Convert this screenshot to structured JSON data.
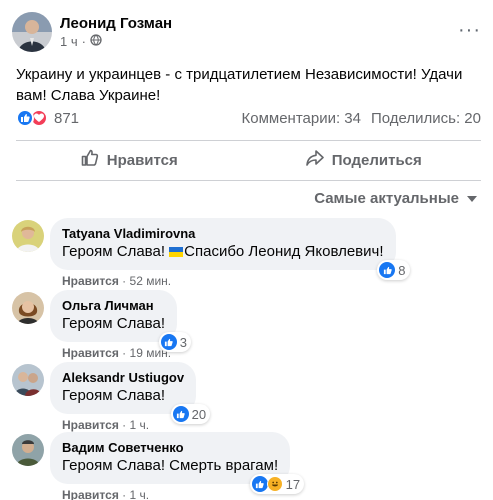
{
  "post": {
    "author": "Леонид Гозман",
    "time": "1 ч",
    "separator": "·",
    "more": "···",
    "text": "Украину и украинцев - с тридцатилетием Независимости! Удачи вам! Слава Украине!"
  },
  "stats": {
    "reactions": "871",
    "comments": "Комментарии: 34",
    "shares": "Поделились: 20"
  },
  "actions": {
    "like": "Нравится",
    "share": "Поделиться"
  },
  "sort": {
    "label": "Самые актуальные"
  },
  "comments": [
    {
      "name": "Tatyana Vladimirovna",
      "text_a": "Героям Слава! ",
      "text_b": "Спасибо Леонид Яковлевич!",
      "like": "Нравится",
      "sep": "·",
      "time": "52 мин.",
      "reactions": "8"
    },
    {
      "name": "Ольга Личман",
      "text": "Героям Слава!",
      "like": "Нравится",
      "sep": "·",
      "time": "19 мин.",
      "reactions": "3"
    },
    {
      "name": "Aleksandr Ustiugov",
      "text": "Героям Слава!",
      "like": "Нравится",
      "sep": "·",
      "time": "1 ч.",
      "reactions": "20"
    },
    {
      "name": "Вадим Советченко",
      "text": "Героям Слава! Смерть врагам!",
      "like": "Нравится",
      "sep": "·",
      "time": "1 ч.",
      "reactions": "17"
    }
  ],
  "colors": {
    "brand_blue": "#1877f2",
    "love_red": "#f33e58",
    "muted": "#65676b",
    "bubble": "#f0f2f5"
  }
}
